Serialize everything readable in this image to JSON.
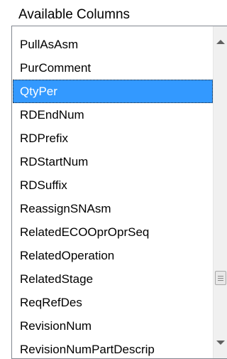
{
  "panel": {
    "title": "Available Columns"
  },
  "list": {
    "items": [
      {
        "label": "PullAsAsm",
        "selected": false
      },
      {
        "label": "PurComment",
        "selected": false
      },
      {
        "label": "QtyPer",
        "selected": true
      },
      {
        "label": "RDEndNum",
        "selected": false
      },
      {
        "label": "RDPrefix",
        "selected": false
      },
      {
        "label": "RDStartNum",
        "selected": false
      },
      {
        "label": "RDSuffix",
        "selected": false
      },
      {
        "label": "ReassignSNAsm",
        "selected": false
      },
      {
        "label": "RelatedECOOprOprSeq",
        "selected": false
      },
      {
        "label": "RelatedOperation",
        "selected": false
      },
      {
        "label": "RelatedStage",
        "selected": false
      },
      {
        "label": "ReqRefDes",
        "selected": false
      },
      {
        "label": "RevisionNum",
        "selected": false
      },
      {
        "label": "RevisionNumPartDescrip",
        "selected": false
      }
    ]
  },
  "scrollbar": {
    "position_fraction": 0.82,
    "up_icon": "arrow-up-icon",
    "down_icon": "arrow-down-icon",
    "thumb_icon": "grip-icon"
  },
  "colors": {
    "selection": "#3399ff",
    "selection_text": "#ffffff",
    "border": "#828790"
  }
}
